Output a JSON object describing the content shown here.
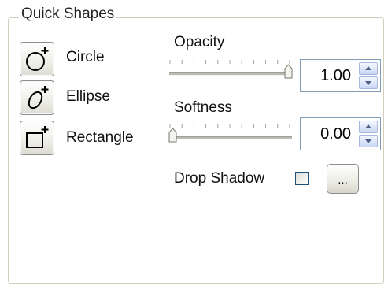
{
  "group": {
    "title": "Quick Shapes"
  },
  "shapes": {
    "circle": "Circle",
    "ellipse": "Ellipse",
    "rectangle": "Rectangle"
  },
  "opacity": {
    "label": "Opacity",
    "value": "1.00",
    "slider_level": 1.0
  },
  "softness": {
    "label": "Softness",
    "value": "0.00",
    "slider_level": 0.0
  },
  "drop_shadow": {
    "label": "Drop Shadow",
    "checked": false,
    "browse_label": "..."
  }
}
